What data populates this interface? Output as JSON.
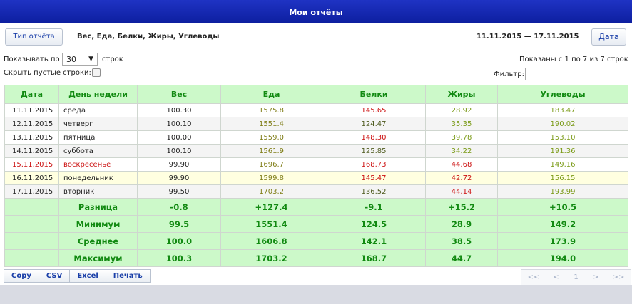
{
  "title": "Мои отчёты",
  "toolbar": {
    "report_type_label": "Тип отчёта",
    "report_columns": "Вес, Еда, Белки, Жиры, Углеводы",
    "date_range": "11.11.2015 — 17.11.2015",
    "date_label": "Дата"
  },
  "controls": {
    "show_prefix": "Показывать по",
    "page_size": "30",
    "show_suffix": "строк",
    "hide_empty_label": "Скрыть пустые строки:",
    "shown_info": "Показаны с 1 по 7 из 7 строк",
    "filter_label": "Фильтр:",
    "filter_value": ""
  },
  "table": {
    "headers": [
      "Дата",
      "День недели",
      "Вес",
      "Еда",
      "Белки",
      "Жиры",
      "Углеводы"
    ],
    "rows": [
      [
        "11.11.2015",
        "среда",
        "100.30",
        "1575.8",
        "145.65",
        "28.92",
        "183.47"
      ],
      [
        "12.11.2015",
        "четверг",
        "100.10",
        "1551.4",
        "124.47",
        "35.35",
        "190.02"
      ],
      [
        "13.11.2015",
        "пятница",
        "100.00",
        "1559.0",
        "148.30",
        "39.78",
        "153.10"
      ],
      [
        "14.11.2015",
        "суббота",
        "100.10",
        "1561.9",
        "125.85",
        "34.22",
        "191.36"
      ],
      [
        "15.11.2015",
        "воскресенье",
        "99.90",
        "1696.7",
        "168.73",
        "44.68",
        "149.16"
      ],
      [
        "16.11.2015",
        "понедельник",
        "99.90",
        "1599.8",
        "145.47",
        "42.72",
        "156.15"
      ],
      [
        "17.11.2015",
        "вторник",
        "99.50",
        "1703.2",
        "136.52",
        "44.14",
        "193.99"
      ]
    ],
    "summary": [
      [
        "Разница",
        "-0.8",
        "+127.4",
        "-9.1",
        "+15.2",
        "+10.5"
      ],
      [
        "Минимум",
        "99.5",
        "1551.4",
        "124.5",
        "28.9",
        "149.2"
      ],
      [
        "Среднее",
        "100.0",
        "1606.8",
        "142.1",
        "38.5",
        "173.9"
      ],
      [
        "Максимум",
        "100.3",
        "1703.2",
        "168.7",
        "44.7",
        "194.0"
      ]
    ]
  },
  "export": {
    "copy": "Copy",
    "csv": "CSV",
    "excel": "Excel",
    "print": "Печать"
  },
  "pager": {
    "first": "<<",
    "prev": "<",
    "current": "1",
    "next": ">",
    "last": ">>"
  },
  "colors": {
    "title_bar": "#1428b8",
    "header_bg": "#ccf9c9",
    "header_text": "#128a12",
    "highlight_row": "#ffffe0",
    "weekend_text": "#cc1111"
  }
}
